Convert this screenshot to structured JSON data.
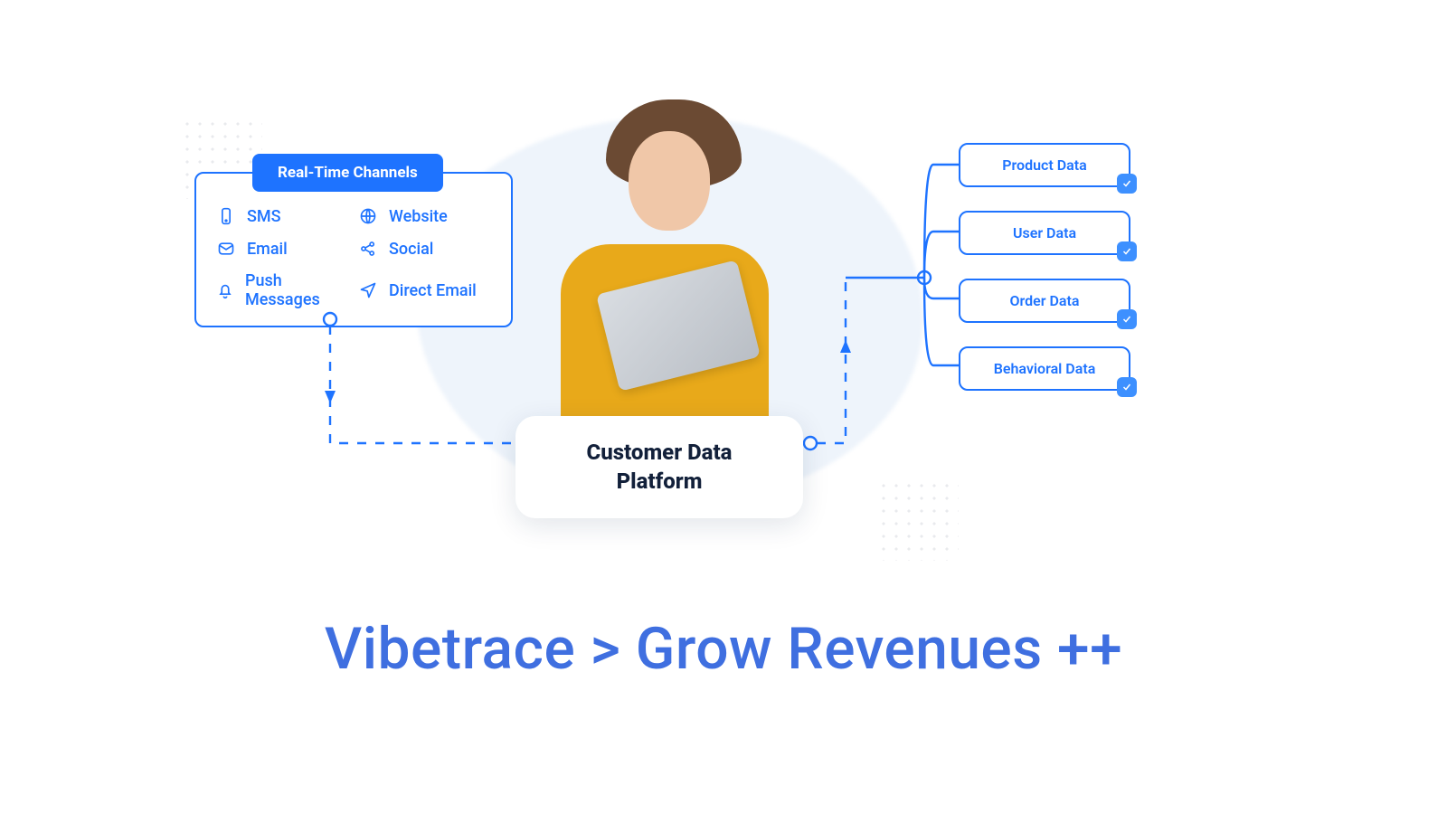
{
  "channels": {
    "title": "Real-Time Channels",
    "items": [
      {
        "icon": "smartphone-icon",
        "label": "SMS"
      },
      {
        "icon": "globe-icon",
        "label": "Website"
      },
      {
        "icon": "mail-icon",
        "label": "Email"
      },
      {
        "icon": "share-icon",
        "label": "Social"
      },
      {
        "icon": "bell-icon",
        "label": "Push Messages"
      },
      {
        "icon": "send-icon",
        "label": "Direct Email"
      }
    ]
  },
  "platform": {
    "title_line1": "Customer Data",
    "title_line2": "Platform"
  },
  "data_sources": [
    {
      "label": "Product Data"
    },
    {
      "label": "User Data"
    },
    {
      "label": "Order Data"
    },
    {
      "label": "Behavioral Data"
    }
  ],
  "tagline": "Vibetrace > Grow Revenues ++",
  "colors": {
    "brand_blue": "#1e73ff",
    "tagline_blue": "#3f6fe0"
  }
}
